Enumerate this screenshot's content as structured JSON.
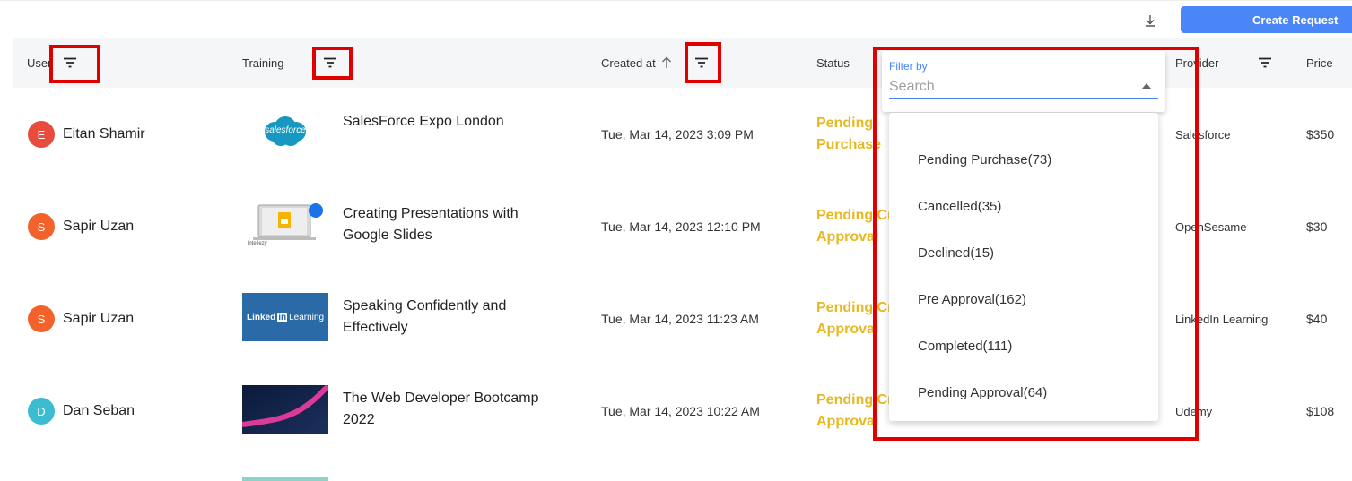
{
  "toolbar": {
    "create_label": "Create Request",
    "download_icon": "download-icon"
  },
  "table": {
    "headers": {
      "user": "User",
      "training": "Training",
      "created": "Created at",
      "status": "Status",
      "provider": "Provider",
      "price": "Price"
    },
    "rows": [
      {
        "avatar_letter": "E",
        "avatar_color": "#e84c3d",
        "user": "Eitan Shamir",
        "thumb": "salesforce-logo",
        "thumb_text": "salesforce",
        "training": "SalesForce Expo London",
        "created": "Tue, Mar 14, 2023 3:09 PM",
        "status": "Pending Purchase",
        "provider": "Salesforce",
        "price": "$350"
      },
      {
        "avatar_letter": "S",
        "avatar_color": "#f4622c",
        "user": "Sapir Uzan",
        "thumb": "google-slides-thumbnail",
        "thumb_text": "intellezy",
        "training": "Creating Presentations with Google Slides",
        "created": "Tue, Mar 14, 2023 12:10 PM",
        "status": "Pending Cr Approval",
        "provider": "OpenSesame",
        "price": "$30"
      },
      {
        "avatar_letter": "S",
        "avatar_color": "#f4622c",
        "user": "Sapir Uzan",
        "thumb": "linkedin-learning-thumbnail",
        "thumb_text": "Linked",
        "thumb_text_b": "in",
        "thumb_text_c": "Learning",
        "training": "Speaking Confidently and Effectively",
        "created": "Tue, Mar 14, 2023 11:23 AM",
        "status": "Pending Cr Approval",
        "provider": "LinkedIn Learning",
        "price": "$40"
      },
      {
        "avatar_letter": "D",
        "avatar_color": "#3bbcd0",
        "user": "Dan Seban",
        "thumb": "web-bootcamp-thumbnail",
        "training": "The Web Developer Bootcamp 2022",
        "created": "Tue, Mar 14, 2023 10:22 AM",
        "status": "Pending Cr Approval",
        "provider": "Udemy",
        "price": "$108"
      }
    ]
  },
  "status_filter": {
    "label": "Filter by",
    "placeholder": "Search",
    "options": [
      "Pending Purchase(73)",
      "Cancelled(35)",
      "Declined(15)",
      "Pre Approval(162)",
      "Completed(111)",
      "Pending Approval(64)"
    ]
  },
  "colors": {
    "accent": "#4a86f7",
    "status": "#e8b820",
    "highlight": "#e00000"
  }
}
